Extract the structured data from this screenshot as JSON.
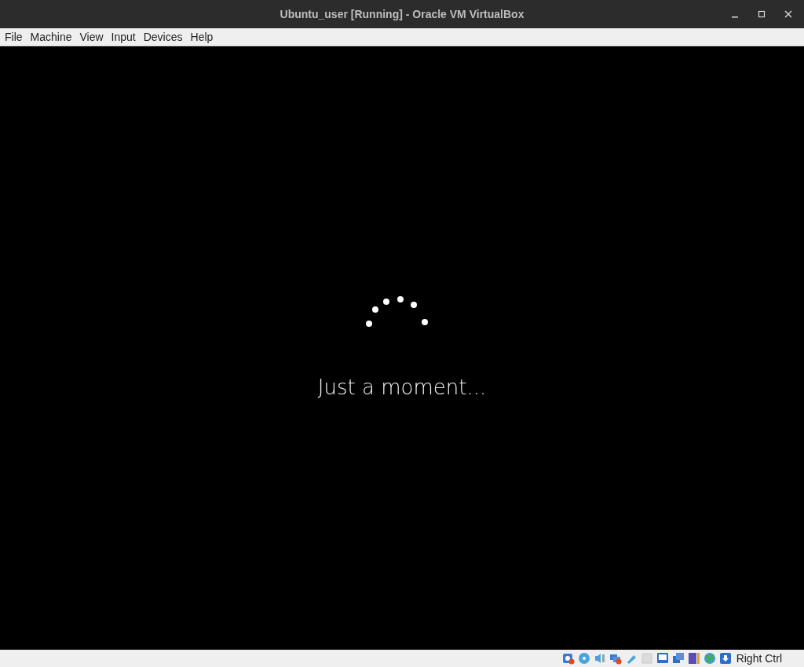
{
  "window": {
    "title": "Ubuntu_user [Running] - Oracle VM VirtualBox"
  },
  "menu": [
    "File",
    "Machine",
    "View",
    "Input",
    "Devices",
    "Help"
  ],
  "screen": {
    "message": "Just a moment..."
  },
  "status_bar": {
    "host_key": "Right Ctrl"
  }
}
